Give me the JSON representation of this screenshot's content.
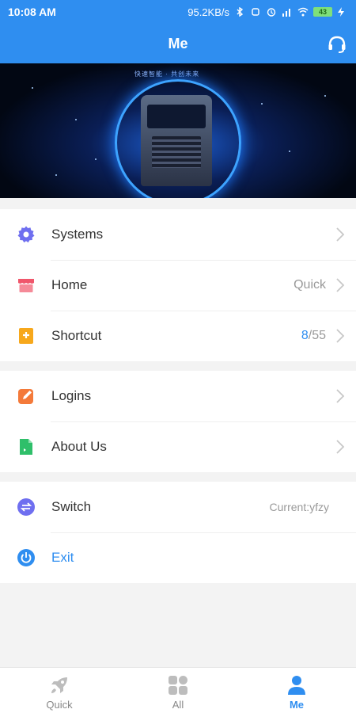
{
  "status_bar": {
    "time": "10:08 AM",
    "net_speed": "95.2KB/s",
    "battery": "43"
  },
  "header": {
    "title": "Me",
    "support_icon": "headset-icon"
  },
  "banner": {
    "slogan": "快速智能 · 共创未来",
    "image": "truck-banner"
  },
  "group1": [
    {
      "label": "Systems",
      "icon": "gear-icon",
      "value": ""
    },
    {
      "label": "Home",
      "icon": "store-icon",
      "value": "Quick"
    },
    {
      "label": "Shortcut",
      "icon": "bookmark-plus-icon",
      "value_highlight": "8",
      "value_rest": "/55"
    }
  ],
  "group2": [
    {
      "label": "Logins",
      "icon": "edit-icon"
    },
    {
      "label": "About Us",
      "icon": "document-icon"
    }
  ],
  "group3": [
    {
      "label": "Switch",
      "icon": "swap-icon",
      "value": "Current:yfzy"
    },
    {
      "label": "Exit",
      "icon": "power-icon"
    }
  ],
  "tabs": [
    {
      "label": "Quick",
      "icon": "rocket-icon",
      "active": false
    },
    {
      "label": "All",
      "icon": "grid-icon",
      "active": false
    },
    {
      "label": "Me",
      "icon": "person-icon",
      "active": true
    }
  ],
  "colors": {
    "accent": "#2f8ef0",
    "gear": "#6f6ff0",
    "store": "#f0566b",
    "bookmark": "#f7a81c",
    "edit": "#f47a3a",
    "document": "#2fbf6a",
    "swap": "#6f6ff0",
    "power": "#2f8ef0"
  }
}
